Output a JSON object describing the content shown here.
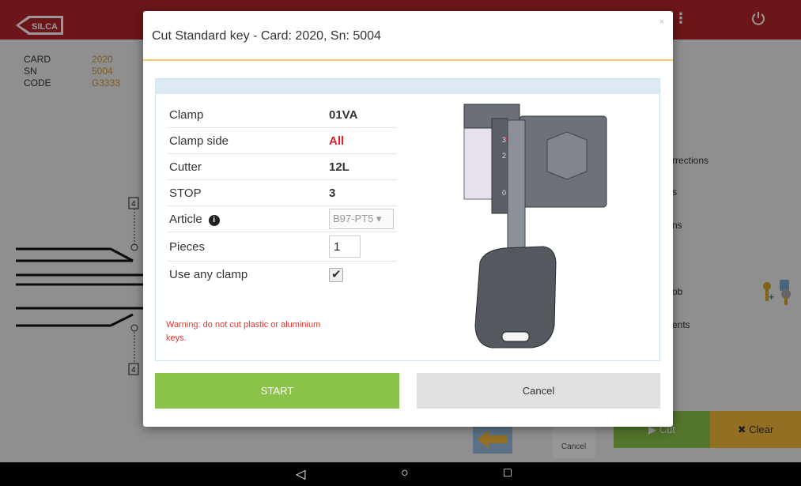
{
  "app": {
    "info": [
      {
        "key": "CARD",
        "value": "2020"
      },
      {
        "key": "SN",
        "value": "5004"
      },
      {
        "key": "CODE",
        "value": "G3333"
      }
    ],
    "right_menu": [
      "rrections",
      "s",
      "ns",
      "ob",
      "ents"
    ],
    "diagram_labels": [
      "4",
      "4"
    ],
    "bottom": {
      "cancel_label": "Cancel",
      "cut_label": "Cut",
      "clear_label": "Clear"
    }
  },
  "modal": {
    "title": "Cut Standard key - Card: 2020, Sn: 5004",
    "close": "×",
    "rows": [
      {
        "label": "Clamp",
        "value": "01VA"
      },
      {
        "label": "Clamp side",
        "value": "All"
      },
      {
        "label": "Cutter",
        "value": "12L"
      },
      {
        "label": "STOP",
        "value": "3"
      }
    ],
    "article": {
      "label": "Article",
      "value": "B97-PT5"
    },
    "pieces": {
      "label": "Pieces",
      "value": "1"
    },
    "use_any_clamp": {
      "label": "Use any clamp",
      "checked": true
    },
    "warning": "Warning: do not cut plastic or aluminium keys.",
    "start_label": "START",
    "cancel_label": "Cancel"
  },
  "navbar": {
    "back": "◁",
    "home": "○",
    "recents": "□"
  },
  "colors": {
    "brand_red": "#b5262b",
    "start_green": "#8bc34a",
    "clear_yellow": "#f4b93a",
    "warning_red": "#e3332d",
    "accent_yellow": "#f5c66a"
  }
}
